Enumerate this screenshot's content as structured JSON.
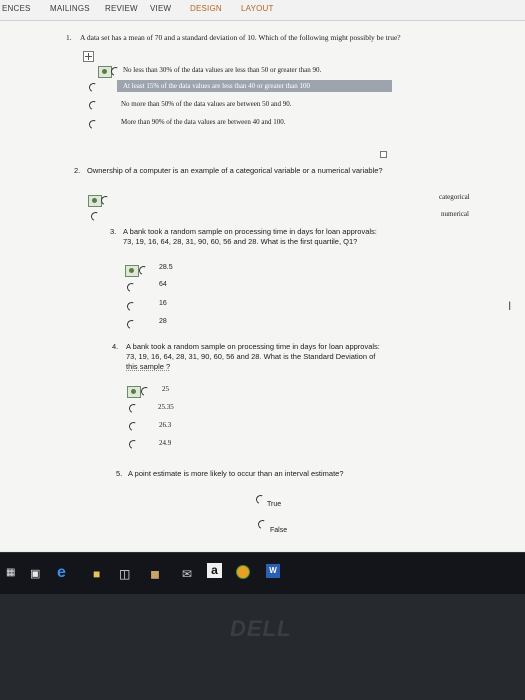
{
  "ribbon": {
    "tabs": [
      "ENCES",
      "MAILINGS",
      "REVIEW",
      "VIEW",
      "DESIGN",
      "LAYOUT"
    ]
  },
  "q1": {
    "number": "1.",
    "text": "A data set has a mean of 70 and a standard deviation of 10. Which of the following might possibly be true?",
    "options": [
      "No less than 30% of the data values are less than 50 or greater than 90.",
      "At least 15% of the data values are less than 40 or greater than 100",
      "No more than 50% of the data values are between 50 and 90.",
      "More than 90% of the data values are between 40 and 100."
    ]
  },
  "q2": {
    "number": "2.",
    "text": "Ownership of a computer is an example of a categorical variable or a numerical variable?",
    "options": [
      "categorical",
      "numerical"
    ]
  },
  "q3": {
    "number": "3.",
    "line1": "A bank took a random sample on processing time in days for loan approvals:",
    "line2": "73, 19, 16, 64, 28, 31, 90, 60, 56 and 28. What is the first quartile, Q1?",
    "options": [
      "28.5",
      "64",
      "16",
      "28"
    ]
  },
  "q4": {
    "number": "4.",
    "line1": "A bank took a random sample on processing time in days for loan approvals:",
    "line2": "73, 19, 16, 64, 28, 31, 90, 60, 56 and 28. What is the Standard Deviation of",
    "line3": "this sample ?",
    "options": [
      "25",
      "25.35",
      "26.3",
      "24.9"
    ]
  },
  "q5": {
    "number": "5.",
    "text": "A point estimate is more likely to occur than an interval estimate?",
    "options": [
      "True",
      "False"
    ]
  },
  "taskbar": {
    "icons": [
      "start-icon",
      "task-view-icon",
      "edge-icon",
      "file-explorer-icon",
      "store-icon",
      "photos-icon",
      "mail-icon",
      "amazon-icon",
      "chrome-icon",
      "word-icon"
    ],
    "amazon_glyph": "a",
    "word_glyph": "W"
  },
  "bezel": {
    "brand": "DELL"
  }
}
